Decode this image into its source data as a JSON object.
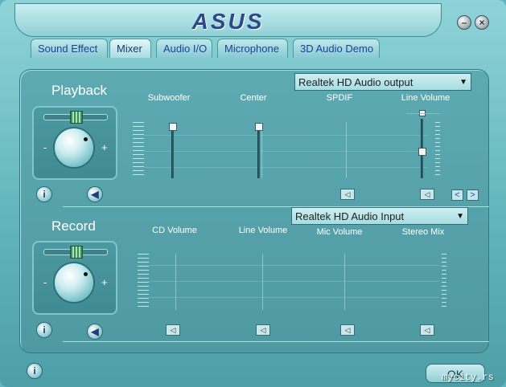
{
  "header": {
    "logo": "ASUS",
    "minimize_icon": "minimize-icon",
    "close_icon": "close-icon"
  },
  "tabs": [
    {
      "label": "Sound Effect"
    },
    {
      "label": "Mixer"
    },
    {
      "label": "Audio I/O"
    },
    {
      "label": "Microphone"
    },
    {
      "label": "3D Audio Demo"
    }
  ],
  "active_tab": "Mixer",
  "playback": {
    "title": "Playback",
    "device": "Realtek HD Audio output",
    "channels": [
      {
        "label": "Subwoofer"
      },
      {
        "label": "Center"
      },
      {
        "label": "SPDIF"
      },
      {
        "label": "Line Volume"
      }
    ],
    "knob_minus": "-",
    "knob_plus": "+"
  },
  "record": {
    "title": "Record",
    "device": "Realtek HD Audio Input",
    "channels": [
      {
        "label": "CD Volume"
      },
      {
        "label": "Line Volume"
      },
      {
        "label": "Mic Volume"
      },
      {
        "label": "Stereo Mix"
      }
    ],
    "knob_minus": "-",
    "knob_plus": "+"
  },
  "footer": {
    "ok": "OK",
    "watermark": "mycity.rs"
  },
  "colors": {
    "accent": "#5fb5bd",
    "tab_text": "#1f3f9a",
    "logo": "#2c4a8a"
  }
}
